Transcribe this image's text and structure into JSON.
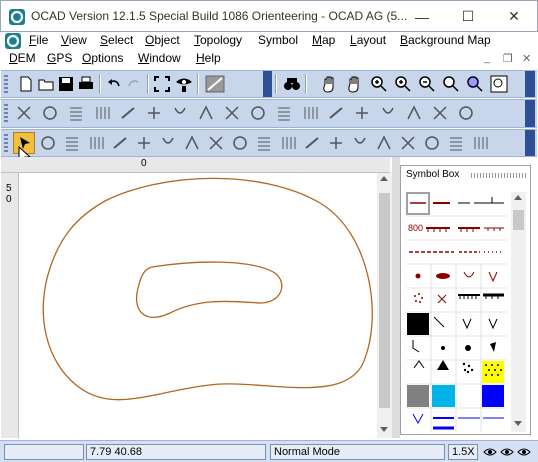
{
  "window": {
    "title": "OCAD Version 12.1.5  Special Build 1086  Orienteering - OCAD AG (5...",
    "minimize_glyph": "—",
    "maximize_glyph": "☐",
    "close_glyph": "✕"
  },
  "menus": {
    "row1": [
      {
        "label": "File",
        "key": "F",
        "rest": "ile"
      },
      {
        "label": "View",
        "key": "V",
        "rest": "iew"
      },
      {
        "label": "Select",
        "key": "S",
        "rest": "elect"
      },
      {
        "label": "Object",
        "key": "O",
        "rest": "bject"
      },
      {
        "label": "Topology",
        "key": "T",
        "rest": "opology"
      },
      {
        "label": "Symbol",
        "key": "",
        "rest": "Symbol"
      },
      {
        "label": "Map",
        "key": "M",
        "rest": "ap"
      },
      {
        "label": "Layout",
        "key": "L",
        "rest": "ayout"
      },
      {
        "label": "Background Map",
        "key": "B",
        "rest": "ackground Map"
      }
    ],
    "row2": [
      {
        "label": "DEM",
        "key": "D",
        "rest": "EM"
      },
      {
        "label": "GPS",
        "key": "G",
        "rest": "PS"
      },
      {
        "label": "Options",
        "key": "O",
        "rest": "ptions"
      },
      {
        "label": "Window",
        "key": "W",
        "rest": "indow"
      },
      {
        "label": "Help",
        "key": "H",
        "rest": "elp"
      }
    ],
    "mdi_minimize": "_",
    "mdi_restore": "❐",
    "mdi_close": "✕"
  },
  "toolbars": {
    "standard": [
      "new-file-icon",
      "open-folder-icon",
      "save-icon",
      "print-icon",
      "undo-icon",
      "redo-icon",
      "fullscreen-icon",
      "view-eye-icon",
      "fill-mode-icon",
      "binoculars-icon",
      "hand-icon",
      "hand-move-icon",
      "zoom-in-icon",
      "zoom-in-page-icon",
      "zoom-out-icon",
      "zoom-fit-icon",
      "zoom-previous-icon",
      "zoom-selection-icon"
    ],
    "edit": [
      "cut-hole-icon",
      "smooth-icon",
      "align-icon",
      "distribute-icon",
      "lines-icon",
      "snap-icon",
      "crop-icon",
      "parallel-icon",
      "merge-icon",
      "split-icon",
      "reverse-icon",
      "curve-icon",
      "join-icon",
      "fill-icon",
      "measure-icon",
      "eraser-icon",
      "dash-icon",
      "arrow-icon"
    ],
    "drawing": [
      "edit-object-icon",
      "edit-point-icon",
      "lasso-icon",
      "add-vertex-icon",
      "delete-vertex-icon",
      "corner-icon",
      "dash-point-icon",
      "cut-icon",
      "rotate-icon",
      "scissors-icon",
      "scissors-cross-icon",
      "x-cut-icon",
      "stretch-icon",
      "move-icon",
      "line-icon",
      "ellipse-icon",
      "circle-icon",
      "freehand-icon",
      "step-line-icon",
      "rectangle-line-icon"
    ]
  },
  "rulers": {
    "top_label": "0",
    "left_label": "5\n0"
  },
  "symbol_box": {
    "title": "Symbol Box",
    "label_800": "800",
    "selected_color": "#a0a0a0",
    "colors": {
      "brown": "#8b0000",
      "black": "#000000",
      "gray": "#808080",
      "cyan": "#00b4e6",
      "blue": "#0000ff",
      "yellow": "#ffff00"
    }
  },
  "statusbar": {
    "coords": "7.79   40.68",
    "mode": "Normal Mode",
    "zoom": "1.5X"
  },
  "map": {
    "contour_color": "#b5651d"
  }
}
